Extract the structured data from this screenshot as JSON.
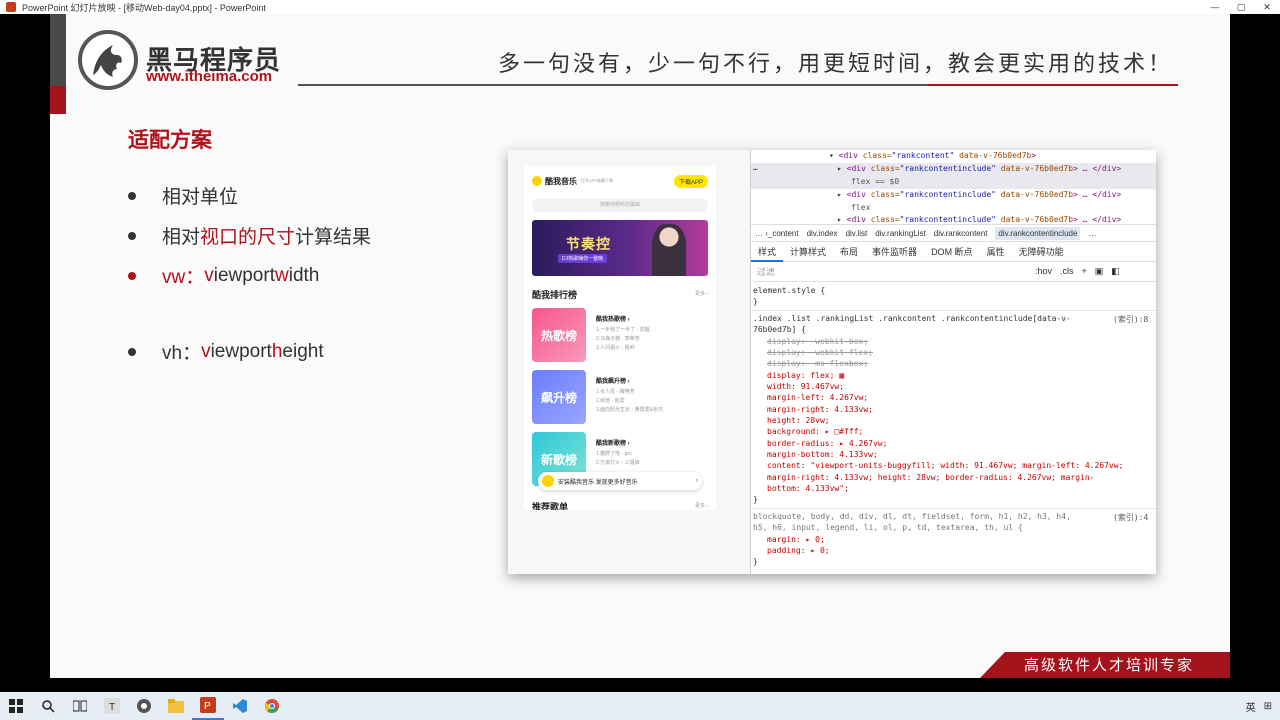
{
  "window": {
    "title": "PowerPoint 幻灯片放映 - [移动Web-day04.pptx] - PowerPoint",
    "controls": [
      "—",
      "▢",
      "✕"
    ]
  },
  "header": {
    "brand_name": "黑马程序员",
    "brand_url": "www.itheima.com",
    "slogan": "多一句没有，少一句不行，用更短时间，教会更实用的技术！"
  },
  "slide": {
    "title": "适配方案",
    "bullets": [
      {
        "plain_before": "相对单位",
        "red": "",
        "plain_after": ""
      },
      {
        "plain_before": "相对",
        "red": "视口的尺寸",
        "plain_after": "计算结果"
      },
      {
        "vw_prefix": "vw：",
        "v": "v",
        "iewport": "iewport ",
        "w": "w",
        "idth": "idth"
      },
      {
        "vh_prefix": "vh：",
        "v": "v",
        "iewport": "iewport ",
        "h": "h",
        "eight": "eight"
      }
    ],
    "bottom_banner": "高级软件人才培训专家"
  },
  "phone": {
    "app_name": "酷我音乐",
    "app_sub": "打开APP收藏下载",
    "download_btn": "下载APP",
    "search_placeholder": "搜索你想听的歌曲",
    "banner_title": "节奏控",
    "banner_sub": "DJ热歌嗨你一整晚",
    "rank_title": "酷我排行榜",
    "more": "更多 ›",
    "cards": [
      {
        "cover": "热歌榜",
        "title": "酷我热歌榜 ›",
        "lines": [
          "1.一半我了一半了 - 苏醒",
          "2.乌梅子酱 - 李荣浩",
          "3.人间烟火 - 程响"
        ],
        "color1": "#f7568c",
        "color2": "#f99ab8"
      },
      {
        "cover": "飙升榜",
        "title": "酷我飙升榜 ›",
        "lines": [
          "1.女人花 - 梅艳芳",
          "2.就他 - 赵雷",
          "3.面向阳光生长 - 黄霄雲&张杰"
        ],
        "color1": "#6a7dfc",
        "color2": "#9aa6ff"
      },
      {
        "cover": "新歌榜",
        "title": "酷我新歌榜 ›",
        "lines": [
          "1.撒野了啦 - pro",
          "2.万家灯火 - 三姐妹"
        ],
        "color1": "#2fc7d8",
        "color2": "#7fe3d3"
      }
    ],
    "install_text": "安装酷我音乐 发现更多好音乐",
    "install_arrow": "›",
    "rec_title": "推荐歌单"
  },
  "devtools": {
    "dom": [
      {
        "arrow": "▾",
        "tag_open": "<div ",
        "attr": "class=",
        "val": "\"rankcontent\"",
        "attr2": " data-v-76b0ed7b",
        "close": ">"
      },
      {
        "arrow": "▸",
        "tag_open": "<div ",
        "attr": "class=",
        "val": "\"rankcontentinclude\"",
        "attr2": " data-v-76b0ed7b",
        "close": "> … </div>"
      },
      {
        "text": "flex == $0"
      },
      {
        "arrow": "▸",
        "tag_open": "<div ",
        "attr": "class=",
        "val": "\"rankcontentinclude\"",
        "attr2": " data-v-76b0ed7b",
        "close": "> … </div>"
      },
      {
        "text": "flex"
      },
      {
        "arrow": "▸",
        "tag_open": "<div ",
        "attr": "class=",
        "val": "\"rankcontentinclude\"",
        "attr2": " data-v-76b0ed7b",
        "close": "> … </div>"
      }
    ],
    "dots": "…",
    "crumbs": [
      "… ‹_content",
      "div.index",
      "div.list",
      "div.rankingList",
      "div.rankcontent",
      "div.rankcontentinclude",
      "…"
    ],
    "tabs": [
      "样式",
      "计算样式",
      "布局",
      "事件监听器",
      "DOM 断点",
      "属性",
      "无障碍功能"
    ],
    "filter_placeholder": "过滤",
    "filter_right": [
      ":hov",
      ".cls",
      "+"
    ],
    "css": {
      "element_style": "element.style {",
      "close": "}",
      "rule_selector": ".index .list .rankingList .rankcontent .rankcontentinclude[data-v-",
      "rule_selector2": "76b0ed7b] {",
      "rule_source": "(索引):8",
      "decls": [
        {
          "text": "display: -webkit-box;",
          "strike": true
        },
        {
          "text": "display: -webkit-flex;",
          "strike": true
        },
        {
          "text": "display: -ms-flexbox;",
          "strike": true
        },
        {
          "text": "display: flex; ▦",
          "strike": false
        },
        {
          "text": "width: 91.467vw;",
          "strike": false
        },
        {
          "text": "margin-left: 4.267vw;",
          "strike": false
        },
        {
          "text": "margin-right: 4.133vw;",
          "strike": false
        },
        {
          "text": "height: 28vw;",
          "strike": false
        },
        {
          "text": "background: ▸ □#fff;",
          "strike": false
        },
        {
          "text": "border-radius: ▸ 4.267vw;",
          "strike": false
        },
        {
          "text": "margin-bottom: 4.133vw;",
          "strike": false
        },
        {
          "text": "content: \"viewport-units-buggyfill; width: 91.467vw; margin-left: 4.267vw;",
          "strike": false
        },
        {
          "text": "    margin-right: 4.133vw; height: 28vw; border-radius: 4.267vw; margin-",
          "strike": false
        },
        {
          "text": "    bottom: 4.133vw\";",
          "strike": false
        }
      ],
      "rule2_selector": "blockquote, body, dd, div, dl, dt, fieldset, form, h1, h2, h3, h4,",
      "rule2_selector2": "h5, h6, input, legend, li, ol, p, td, textarea, th, ul {",
      "rule2_source": "(索引):4",
      "rule2_decls": [
        "margin: ▸ 0;",
        "padding: ▸ 0;"
      ]
    }
  },
  "taskbar": {
    "icons": [
      "windows-start",
      "search",
      "task-view",
      "typora",
      "chrome-gray",
      "file-explorer",
      "powerpoint",
      "vscode",
      "chrome"
    ],
    "tray": [
      "英",
      "⊞"
    ]
  }
}
